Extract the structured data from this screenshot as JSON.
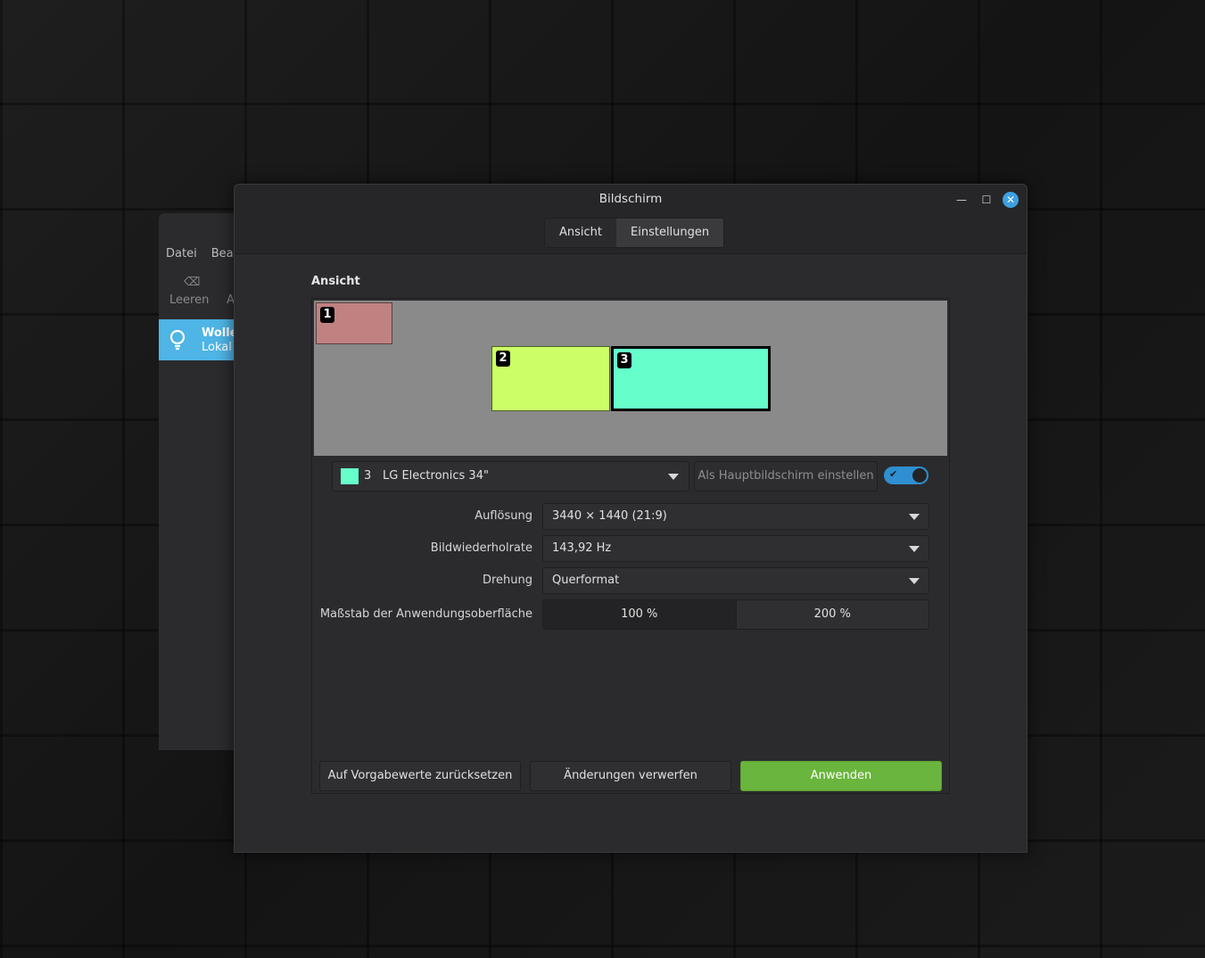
{
  "background_window": {
    "menu": [
      "Datei",
      "Bear"
    ],
    "toolbar_label": "Leeren",
    "toolbar_label2": "A",
    "item_title": "Wolle",
    "item_subtitle": "Lokal"
  },
  "dialog": {
    "title": "Bildschirm",
    "tabs": [
      {
        "label": "Ansicht",
        "active": false
      },
      {
        "label": "Einstellungen",
        "active": true
      }
    ],
    "section_label": "Ansicht"
  },
  "monitors": [
    {
      "number": "1",
      "color": "#c08181"
    },
    {
      "number": "2",
      "color": "#ccff66"
    },
    {
      "number": "3",
      "color": "#66ffcc",
      "selected": true
    }
  ],
  "selected_monitor": {
    "number": "3",
    "name": "LG Electronics 34\"",
    "color": "#66ffcc"
  },
  "set_primary_label": "Als Hauptbildschirm einstellen",
  "monitor_enabled": true,
  "settings": {
    "resolution_label": "Auflösung",
    "resolution_value": "3440 × 1440 (21:9)",
    "refresh_label": "Bildwiederholrate",
    "refresh_value": "143,92 Hz",
    "rotation_label": "Drehung",
    "rotation_value": "Querformat",
    "scale_label": "Maßstab der Anwendungsoberfläche",
    "scale_options": [
      "100 %",
      "200 %"
    ],
    "scale_selected": "100 %"
  },
  "buttons": {
    "reset": "Auf Vorgabewerte zurücksetzen",
    "discard": "Änderungen verwerfen",
    "apply": "Anwenden"
  },
  "colors": {
    "accent": "#3ea0e0",
    "apply": "#6ab53d",
    "toggle": "#2f8fd0"
  }
}
